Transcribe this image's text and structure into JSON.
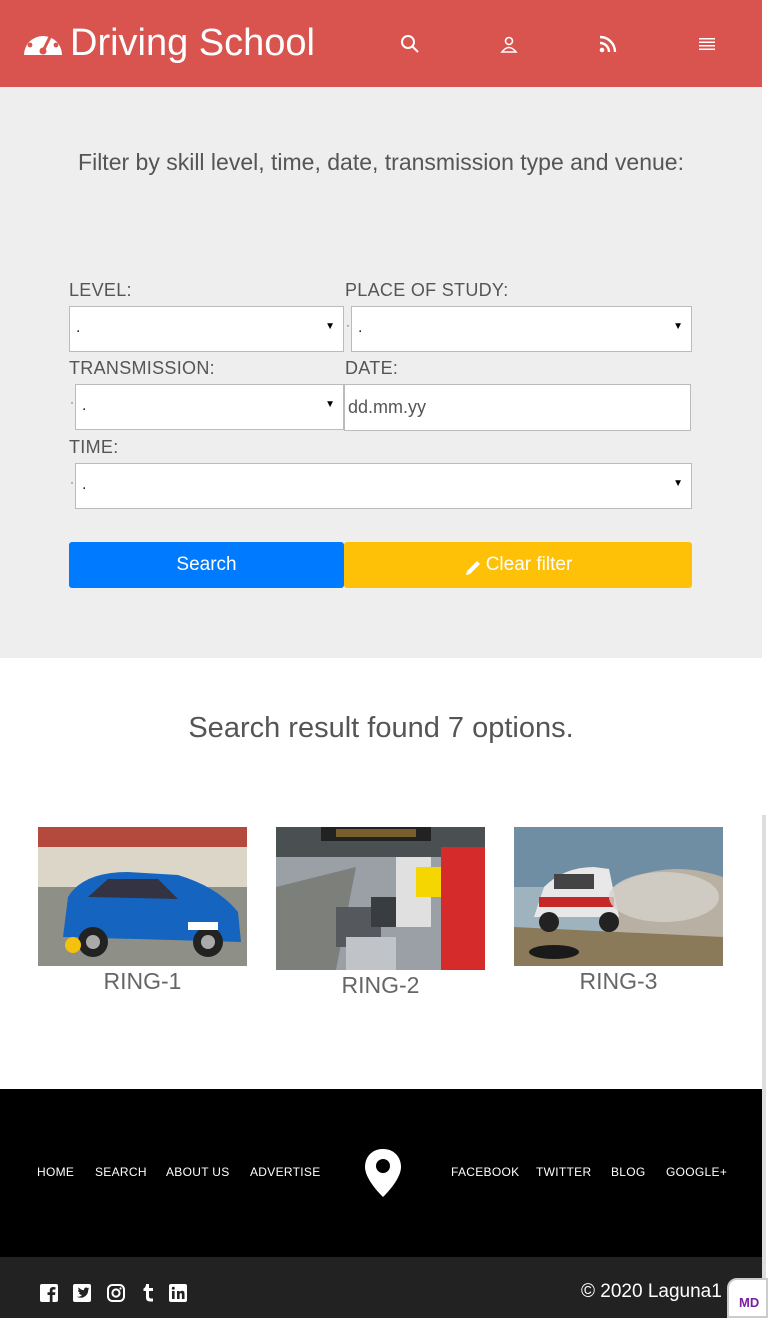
{
  "header": {
    "brand": "Driving School",
    "colors": {
      "background": "#d9534f",
      "text": "#ffffff"
    },
    "icons": [
      "speedometer-icon",
      "search-icon",
      "user-icon",
      "rss-icon",
      "menu-icon"
    ]
  },
  "filter": {
    "title": "Filter by skill level, time, date, transmission type and venue:",
    "level_label": "LEVEL:",
    "level_value": ".",
    "place_label": "PLACE OF STUDY:",
    "place_value": ".",
    "transmission_label": "TRANSMISSION:",
    "transmission_value": ".",
    "date_label": "DATE:",
    "date_placeholder": "dd.mm.yy",
    "time_label": "TIME:",
    "time_value": ".",
    "search_button": "Search",
    "clear_button": "Clear filter",
    "colors": {
      "search": "#007bff",
      "clear": "#ffc107",
      "background": "#eeeeee"
    }
  },
  "results": {
    "summary": "Search result found 7 options.",
    "cards": [
      {
        "label": "RING-1"
      },
      {
        "label": "RING-2"
      },
      {
        "label": "RING-3"
      }
    ]
  },
  "footer": {
    "left_links": [
      "HOME",
      "SEARCH",
      "ABOUT US",
      "ADVERTISE"
    ],
    "right_links": [
      "FACEBOOK",
      "TWITTER",
      "BLOG",
      "GOOGLE+"
    ],
    "social_icons": [
      "facebook-icon",
      "twitter-icon",
      "instagram-icon",
      "tumblr-icon",
      "linkedin-icon"
    ],
    "copyright": "© 2020 Laguna1",
    "badge": "MD"
  }
}
